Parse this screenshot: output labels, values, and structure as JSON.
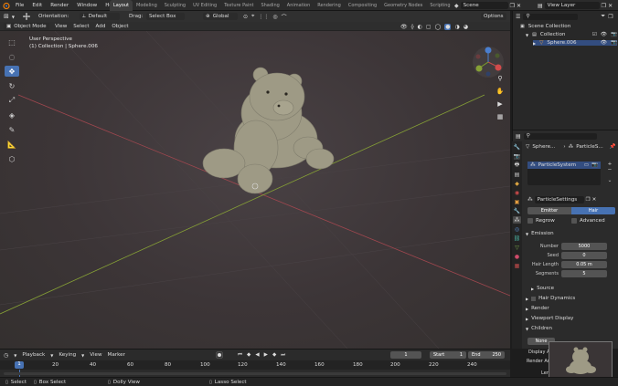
{
  "topbar": {
    "menus": [
      "File",
      "Edit",
      "Render",
      "Window",
      "Help"
    ],
    "workspaces": [
      "Layout",
      "Modeling",
      "Sculpting",
      "UV Editing",
      "Texture Paint",
      "Shading",
      "Animation",
      "Rendering",
      "Compositing",
      "Geometry Nodes",
      "Scripting"
    ],
    "active_workspace": "Layout",
    "scene_label": "Scene",
    "view_layer_label": "View Layer"
  },
  "vp_header": {
    "orientation_label": "Orientation:",
    "orientation_value": "Default",
    "drag_label": "Drag:",
    "drag_value": "Select Box",
    "transform_value": "Global",
    "options_label": "Options",
    "mode": "Object Mode",
    "menu": [
      "View",
      "Select",
      "Add",
      "Object"
    ]
  },
  "viewport": {
    "perspective": "User Perspective",
    "collection_info": "(1) Collection | Sphere.006"
  },
  "outliner": {
    "title": "Scene Collection",
    "items": [
      "Collection",
      "Sphere.006"
    ]
  },
  "properties": {
    "search_placeholder": "",
    "object_name": "Sphere...",
    "modifier_name": "ParticleS...",
    "system_name": "ParticleSystem",
    "settings_name": "ParticleSettings",
    "type_emitter": "Emitter",
    "type_hair": "Hair",
    "regrow_label": "Regrow",
    "advanced_label": "Advanced",
    "emission_header": "Emission",
    "fields": [
      {
        "label": "Number",
        "value": "5000"
      },
      {
        "label": "Seed",
        "value": "0"
      },
      {
        "label": "Hair Length",
        "value": "0.05 m"
      },
      {
        "label": "Segments",
        "value": "5"
      }
    ],
    "source_label": "Source",
    "hair_dynamics_label": "Hair Dynamics",
    "render_label": "Render",
    "viewport_display_label": "Viewport Display",
    "children_label": "Children",
    "none_label": "None",
    "display_amount_label": "Display A",
    "render_amount_label": "Render Am",
    "length_label": "Len"
  },
  "timeline": {
    "playback_label": "Playback",
    "keying_label": "Keying",
    "view_label": "View",
    "marker_label": "Marker",
    "current_frame": "1",
    "start_label": "Start",
    "start_value": "1",
    "end_label": "End",
    "end_value": "250",
    "ticks": [
      "1",
      "20",
      "40",
      "60",
      "80",
      "100",
      "120",
      "140",
      "160",
      "180",
      "200",
      "220",
      "240"
    ]
  },
  "statusbar": {
    "select_label": "Select",
    "box_select_label": "Box Select",
    "dolly_label": "Dolly View",
    "lasso_label": "Lasso Select"
  },
  "colors": {
    "accent": "#4772b3",
    "x_axis": "#b34b4b",
    "y_axis": "#7fa32a",
    "bear": "#9e9a85"
  }
}
